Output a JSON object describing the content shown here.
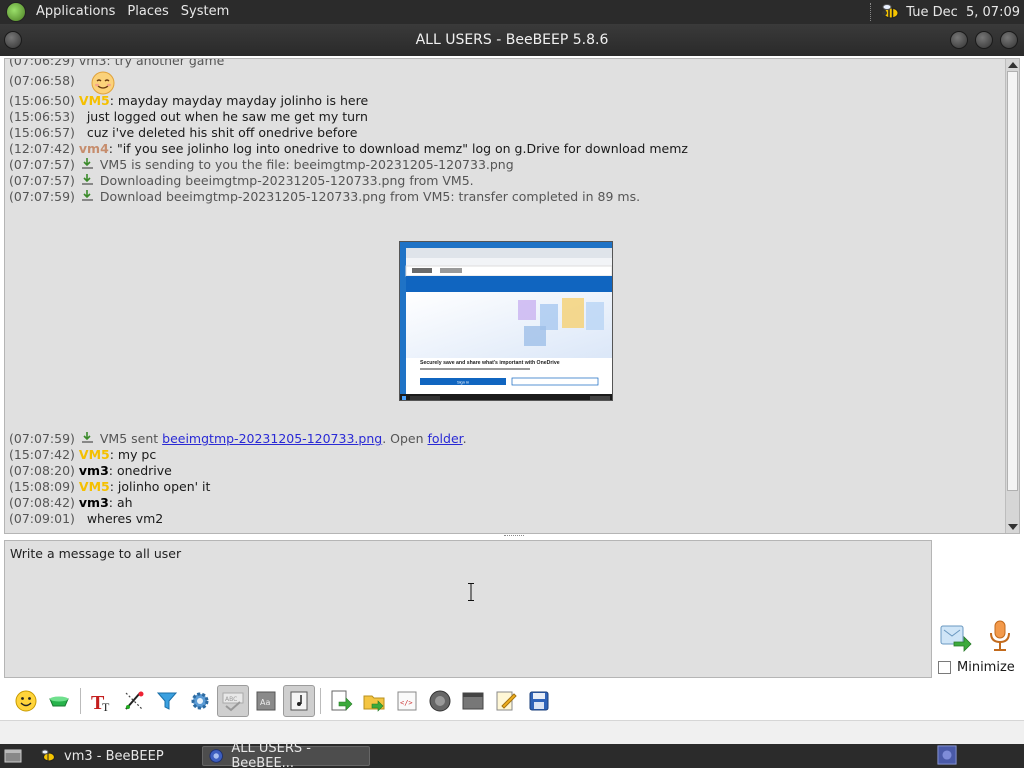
{
  "top_panel": {
    "menus": [
      "Applications",
      "Places",
      "System"
    ],
    "clock": "Tue Dec  5, 07:09"
  },
  "window": {
    "title": "ALL USERS - BeeBEEP 5.8.6"
  },
  "chat": {
    "clipped_top": "(07:06:29) vm3: try another game",
    "lines": [
      {
        "ts": "(07:06:58)",
        "type": "emoji"
      },
      {
        "ts": "(15:06:50)",
        "nick": "VM5",
        "text": ": mayday mayday mayday jolinho is here"
      },
      {
        "ts": "(15:06:53)",
        "text": "just logged out when he saw me get my turn"
      },
      {
        "ts": "(15:06:57)",
        "text": "cuz i've deleted his shit off onedrive before"
      },
      {
        "ts": "(12:07:42)",
        "nick": "vm4",
        "text": ": \"if you see jolinho log into onedrive to download memz\" log on g.Drive for download memz"
      },
      {
        "ts": "(07:07:57)",
        "sys": "VM5 is sending to you the file: beeimgtmp-20231205-120733.png"
      },
      {
        "ts": "(07:07:57)",
        "sys": "Downloading beeimgtmp-20231205-120733.png from VM5."
      },
      {
        "ts": "(07:07:59)",
        "sys": "Download beeimgtmp-20231205-120733.png from VM5: transfer completed in 89 ms."
      }
    ],
    "sent_line": {
      "ts": "(07:07:59)",
      "prefix": "VM5 sent ",
      "file_link": "beeimgtmp-20231205-120733.png",
      "middle": ". Open ",
      "folder_link": "folder",
      "suffix": "."
    },
    "tail_lines": [
      {
        "ts": "(15:07:42)",
        "nick": "VM5",
        "nick_class": "yellow",
        "text": ": my pc"
      },
      {
        "ts": "(07:08:20)",
        "nick": "vm3",
        "nick_class": "vm3",
        "text": ": onedrive"
      },
      {
        "ts": "(15:08:09)",
        "nick": "VM5",
        "nick_class": "yellow",
        "text": ": jolinho open' it"
      },
      {
        "ts": "(07:08:42)",
        "nick": "vm3",
        "nick_class": "vm3",
        "text": ": ah"
      },
      {
        "ts": "(07:09:01)",
        "text": "wheres vm2"
      }
    ],
    "thumbnail": {
      "headline": "Securely save and share what's important with OneDrive",
      "button": "Sign in"
    }
  },
  "input": {
    "placeholder": "Write a message to all user"
  },
  "side": {
    "minimize_label": "Minimize"
  },
  "toolbar_icons": [
    "emoticon-icon",
    "color-icon",
    "font-icon",
    "text-tools-icon",
    "filter-icon",
    "settings-icon",
    "spellcheck-icon",
    "dictionary-icon",
    "note-icon",
    "send-file-icon",
    "send-folder-icon",
    "code-icon",
    "voice-icon",
    "screenshot-icon",
    "edit-icon",
    "save-icon"
  ],
  "taskbar": {
    "items": [
      "vm3 - BeeBEEP",
      "ALL USERS - BeeBEE..."
    ]
  },
  "colors": {
    "panel_bg": "#2b2b2b",
    "chat_bg": "#e0e0e0",
    "nick_vm5": "#f5c000",
    "nick_vm4": "#c68d6d",
    "link": "#2a2ad5"
  }
}
